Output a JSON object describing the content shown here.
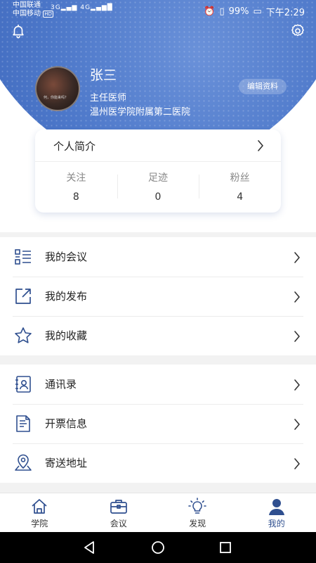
{
  "status_bar": {
    "carrier1": "中国联通",
    "carrier2": "中国移动",
    "hd_badge": "HD",
    "net1": "3G",
    "net2": "4G",
    "battery": "99%",
    "time": "下午2:29"
  },
  "header": {
    "icons": {
      "left": "bell-icon",
      "right": "gear-icon"
    },
    "avatar_caption": "何，你能来吗？",
    "name": "张三",
    "title": "主任医师",
    "hospital": "温州医学院附属第二医院",
    "edit_label": "编辑资料"
  },
  "card": {
    "intro_label": "个人简介",
    "stats": [
      {
        "label": "关注",
        "value": "8"
      },
      {
        "label": "足迹",
        "value": "0"
      },
      {
        "label": "粉丝",
        "value": "4"
      }
    ]
  },
  "menu1": [
    {
      "label": "我的会议",
      "icon": "list-icon"
    },
    {
      "label": "我的发布",
      "icon": "share-icon"
    },
    {
      "label": "我的收藏",
      "icon": "star-icon"
    }
  ],
  "menu2": [
    {
      "label": "通讯录",
      "icon": "contacts-icon"
    },
    {
      "label": "开票信息",
      "icon": "invoice-icon"
    },
    {
      "label": "寄送地址",
      "icon": "location-icon"
    }
  ],
  "tabs": [
    {
      "label": "学院",
      "icon": "home-icon",
      "active": false
    },
    {
      "label": "会议",
      "icon": "briefcase-icon",
      "active": false
    },
    {
      "label": "发现",
      "icon": "bulb-icon",
      "active": false
    },
    {
      "label": "我的",
      "icon": "user-icon",
      "active": true
    }
  ],
  "colors": {
    "header_blue": "#3a63b8",
    "icon_blue": "#2f4f8f",
    "active_tab": "#2f4f8f"
  }
}
